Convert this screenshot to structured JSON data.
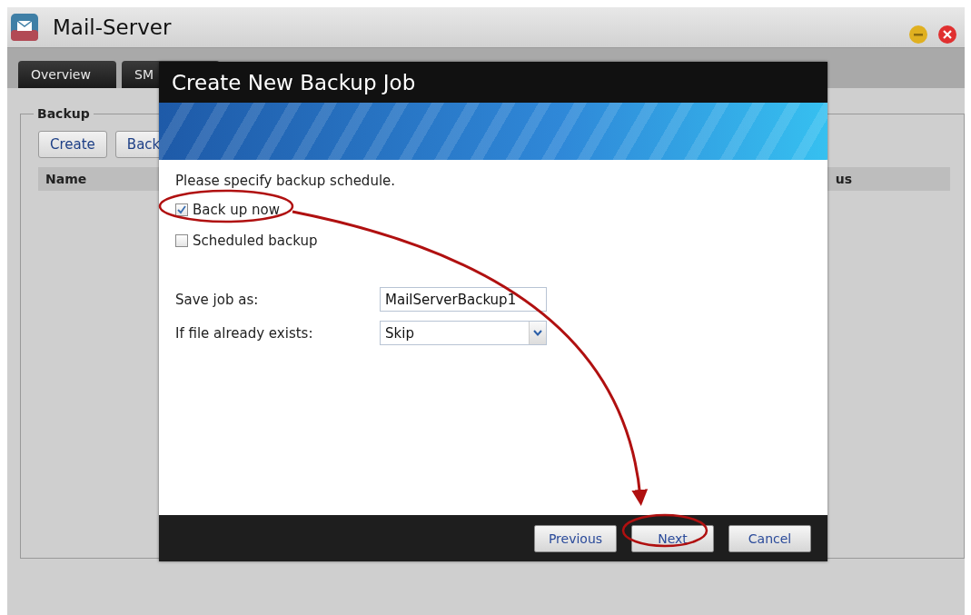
{
  "window": {
    "title": "Mail-Server"
  },
  "tabs": [
    {
      "label": "Overview",
      "selected": false
    },
    {
      "label": "SM",
      "selected": false
    }
  ],
  "backup_panel": {
    "legend": "Backup",
    "buttons": [
      "Create",
      "Back"
    ],
    "table": {
      "columns": [
        "Name",
        "us"
      ]
    }
  },
  "dialog": {
    "title": "Create New Backup Job",
    "instruction": "Please specify backup schedule.",
    "options": [
      {
        "label": "Back up now",
        "checked": true
      },
      {
        "label": "Scheduled backup",
        "checked": false
      }
    ],
    "fields": [
      {
        "kind": "text",
        "label": "Save job as:",
        "value": "MailServerBackup1"
      },
      {
        "kind": "select",
        "label": "If file already exists:",
        "value": "Skip"
      }
    ],
    "buttons": [
      "Previous",
      "Next",
      "Cancel"
    ]
  }
}
